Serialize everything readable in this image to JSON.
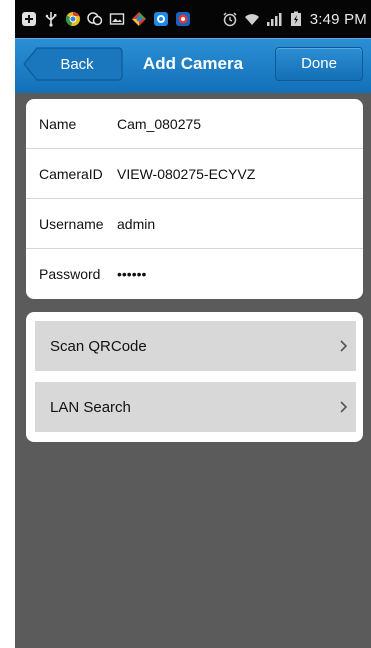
{
  "status_bar": {
    "time": "3:49 PM",
    "icons": [
      "add-icon",
      "usb-icon",
      "chrome-icon",
      "chat-icon",
      "picture-icon",
      "app-icon",
      "camera-app-icon",
      "camera-app-icon-2",
      "alarm-icon",
      "wifi-icon",
      "signal-icon",
      "battery-icon"
    ]
  },
  "nav": {
    "back_label": "Back",
    "title": "Add Camera",
    "done_label": "Done"
  },
  "form": {
    "fields": [
      {
        "label": "Name",
        "value": "Cam_080275"
      },
      {
        "label": "CameraID",
        "value": "VIEW-080275-ECYVZ"
      },
      {
        "label": "Username",
        "value": "admin"
      },
      {
        "label": "Password",
        "value": "••••••"
      }
    ]
  },
  "actions": [
    {
      "label": "Scan QRCode"
    },
    {
      "label": "LAN Search"
    }
  ],
  "colors": {
    "nav_blue": "#1a7cc4",
    "background": "#5b5b5b",
    "action_gray": "#d8d8d8"
  }
}
